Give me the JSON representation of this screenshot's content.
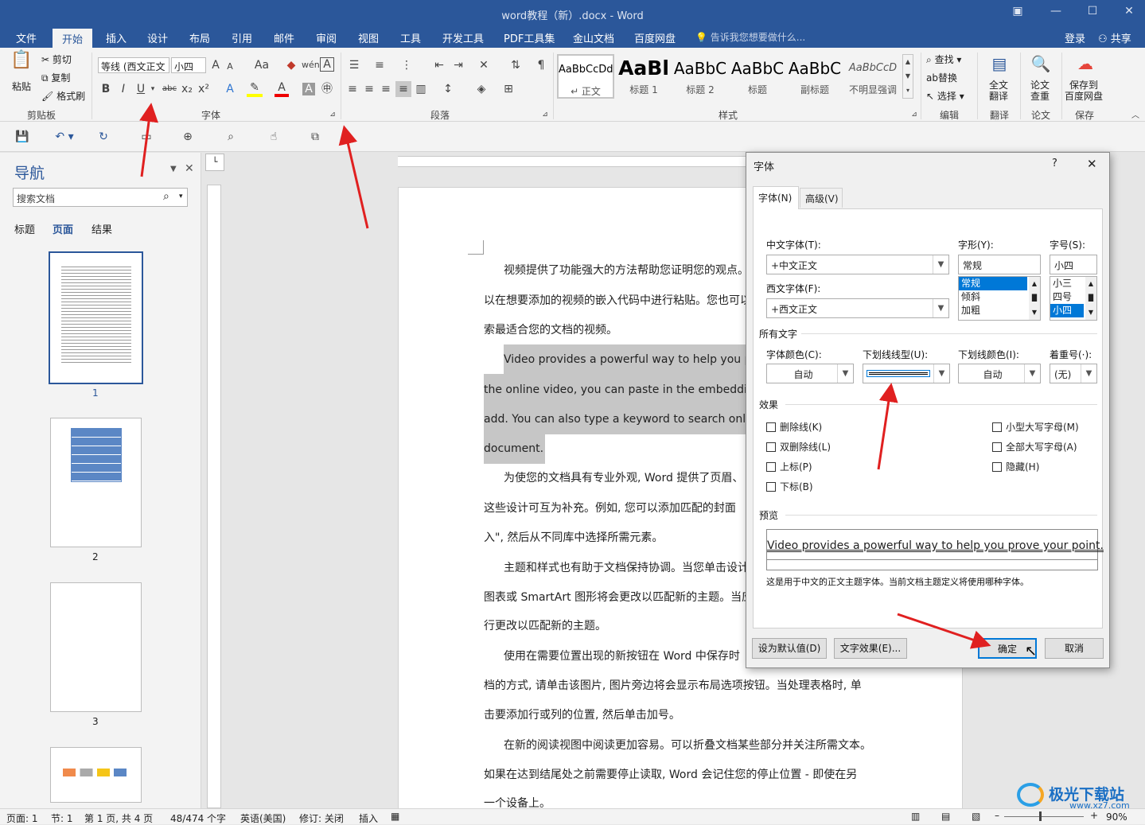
{
  "window": {
    "title": "word教程（新）.docx - Word",
    "min_icon": "ribbon-display-icon"
  },
  "tabs": [
    "文件",
    "开始",
    "插入",
    "设计",
    "布局",
    "引用",
    "邮件",
    "审阅",
    "视图",
    "工具",
    "开发工具",
    "PDF工具集",
    "金山文档",
    "百度网盘"
  ],
  "active_tab": "开始",
  "tell_me": "告诉我您想要做什么...",
  "account": {
    "login": "登录",
    "share": "共享"
  },
  "clipboard": {
    "paste": "粘贴",
    "cut": "剪切",
    "copy": "复制",
    "format_painter": "格式刷",
    "label": "剪贴板"
  },
  "font_group": {
    "font_name": "等线 (西文正文",
    "font_size": "小四",
    "label": "字体",
    "bold": "B",
    "italic": "I",
    "underline": "U",
    "strike": "abc",
    "sub": "x₂",
    "sup": "x²",
    "grow": "A",
    "shrink": "A",
    "case": "Aa",
    "wen": "wén",
    "A_box": "A"
  },
  "paragraph_group": {
    "label": "段落"
  },
  "styles_group": {
    "label": "样式",
    "items": [
      {
        "sample": "AaBbCcDd",
        "name": "↵ 正文"
      },
      {
        "sample": "AaBl",
        "name": "标题 1"
      },
      {
        "sample": "AaBbC",
        "name": "标题 2"
      },
      {
        "sample": "AaBbC",
        "name": "标题"
      },
      {
        "sample": "AaBbC",
        "name": "副标题"
      },
      {
        "sample": "AaBbCcD",
        "name": "不明显强调"
      }
    ]
  },
  "editing_group": {
    "find": "查找",
    "replace": "替换",
    "select": "选择",
    "label": "编辑"
  },
  "extra_groups": [
    {
      "btn": "全文\n翻译",
      "btn_l1": "全文",
      "btn_l2": "翻译",
      "label": "翻译"
    },
    {
      "btn_l1": "论文",
      "btn_l2": "查重",
      "label": "论文"
    },
    {
      "btn_l1": "保存到",
      "btn_l2": "百度网盘",
      "label": "保存"
    }
  ],
  "nav": {
    "title": "导航",
    "search_placeholder": "搜索文档",
    "tabs": [
      "标题",
      "页面",
      "结果"
    ],
    "active_tab": "页面",
    "pages": [
      "1",
      "2",
      "3"
    ]
  },
  "document": {
    "paragraphs": [
      "视频提供了功能强大的方法帮助您证明您的观点。",
      "以在想要添加的视频的嵌入代码中进行粘贴。您也可以",
      "索最适合您的文档的视频。",
      "Video provides a powerful way to help you prove",
      "the online video, you can paste in the embedding cod",
      "add. You can also type a keyword to search online for",
      "document.",
      "为使您的文档具有专业外观, Word  提供了页眉、",
      "这些设计可互为补充。例如, 您可以添加匹配的封面",
      "入\", 然后从不同库中选择所需元素。",
      "主题和样式也有助于文档保持协调。当您单击设计",
      "图表或 SmartArt 图形将会更改以匹配新的主题。当应",
      "行更改以匹配新的主题。",
      "使用在需要位置出现的新按钮在  Word  中保存时",
      "档的方式, 请单击该图片, 图片旁边将会显示布局选项按钮。当处理表格时, 单",
      "击要添加行或列的位置, 然后单击加号。",
      "在新的阅读视图中阅读更加容易。可以折叠文档某些部分并关注所需文本。",
      "如果在达到结尾处之前需要停止读取, Word 会记住您的停止位置 - 即使在另",
      "一个设备上。"
    ]
  },
  "status": {
    "page": "页面: 1",
    "section": "节: 1",
    "page_of": "第 1 页, 共 4 页",
    "words": "48/474 个字",
    "lang": "英语(美国)",
    "track": "修订: 关闭",
    "insert": "插入",
    "zoom": "90%"
  },
  "dialog": {
    "title": "字体",
    "help": "?",
    "close": "✕",
    "tabs": [
      "字体(N)",
      "高级(V)"
    ],
    "cn_font_label": "中文字体(T):",
    "cn_font_value": "+中文正文",
    "west_font_label": "西文字体(F):",
    "west_font_value": "+西文正文",
    "style_label": "字形(Y):",
    "style_value": "常规",
    "style_list": [
      "常规",
      "倾斜",
      "加粗"
    ],
    "size_label": "字号(S):",
    "size_value": "小四",
    "size_list": [
      "小三",
      "四号",
      "小四"
    ],
    "all_text": "所有文字",
    "color_label": "字体颜色(C):",
    "color_value": "自动",
    "underline_label": "下划线线型(U):",
    "underline_color_label": "下划线颜色(I):",
    "underline_color_value": "自动",
    "emphasis_label": "着重号(·):",
    "emphasis_value": "(无)",
    "effects": "效果",
    "effects_left": [
      "删除线(K)",
      "双删除线(L)",
      "上标(P)",
      "下标(B)"
    ],
    "effects_right": [
      "小型大写字母(M)",
      "全部大写字母(A)",
      "隐藏(H)"
    ],
    "preview_label": "预览",
    "preview_text": "Video provides a powerful way to help you prove your point.",
    "preview_note": "这是用于中文的正文主题字体。当前文档主题定义将使用哪种字体。",
    "set_default": "设为默认值(D)",
    "text_effects": "文字效果(E)...",
    "ok": "确定",
    "cancel": "取消"
  },
  "watermark": {
    "brand": "极光下载站",
    "url": "www.xz7.com"
  },
  "colors": {
    "accent": "#2b579a",
    "arrow": "#e02020"
  }
}
